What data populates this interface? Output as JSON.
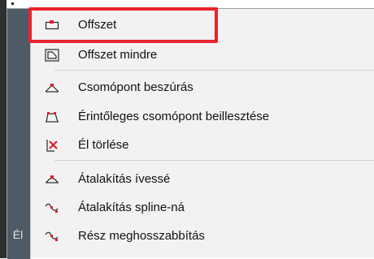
{
  "menu": {
    "side_glyph": "Él",
    "items": [
      {
        "label": "Offszet",
        "icon": "offset-icon"
      },
      {
        "label": "Offszet mindre",
        "icon": "offset-all-icon"
      },
      {
        "label": "Csomópont beszúrás",
        "icon": "insert-node-icon"
      },
      {
        "label": "Érintőleges csomópont beillesztése",
        "icon": "tangent-node-icon"
      },
      {
        "label": "Él törlése",
        "icon": "delete-edge-icon"
      },
      {
        "label": "Átalakítás ívessé",
        "icon": "convert-arc-icon"
      },
      {
        "label": "Átalakítás spline-ná",
        "icon": "convert-spline-icon"
      },
      {
        "label": "Rész meghosszabbítás",
        "icon": "extend-segment-icon"
      }
    ]
  },
  "colors": {
    "highlight": "#e8242c",
    "icon_red": "#e0202a",
    "icon_dark": "#2a2a2a"
  }
}
